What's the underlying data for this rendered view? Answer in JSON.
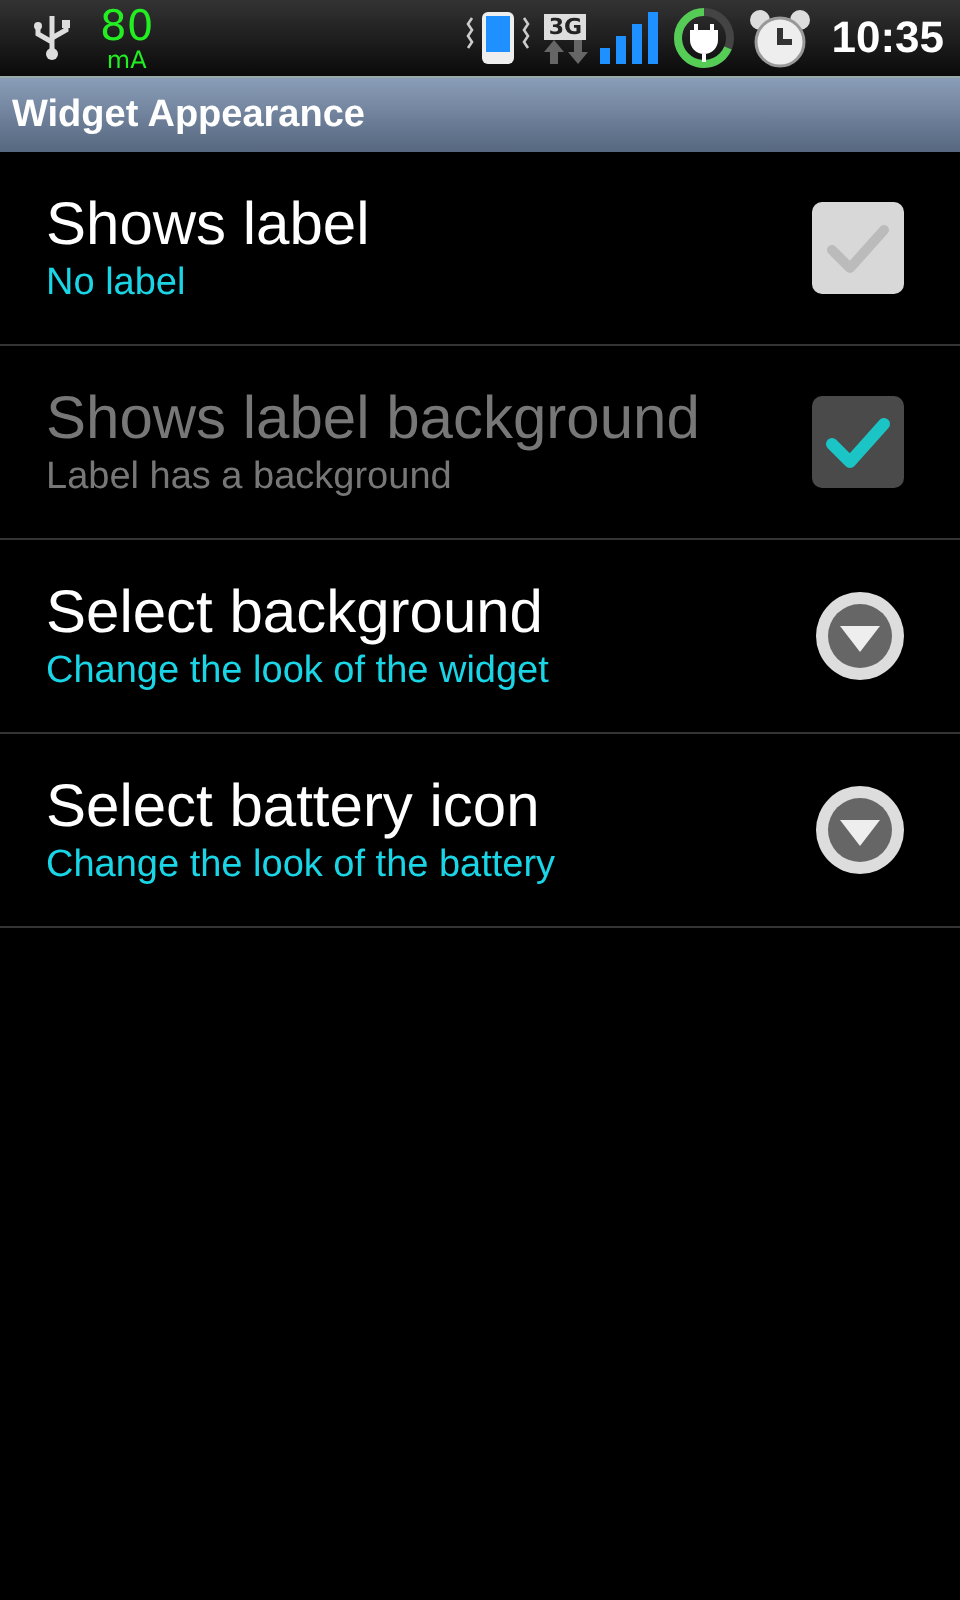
{
  "status_bar": {
    "usb_current": "80",
    "usb_unit": "mA",
    "network": "3G",
    "time": "10:35"
  },
  "title_bar": {
    "title": "Widget Appearance"
  },
  "preferences": [
    {
      "kind": "checkbox",
      "title": "Shows label",
      "summary": "No label",
      "checked": false,
      "disabled": false
    },
    {
      "kind": "checkbox",
      "title": "Shows label background",
      "summary": "Label has a background",
      "checked": true,
      "disabled": true
    },
    {
      "kind": "list",
      "title": "Select background",
      "summary": "Change the look of the widget",
      "disabled": false
    },
    {
      "kind": "list",
      "title": "Select battery icon",
      "summary": "Change the look of the battery",
      "disabled": false
    }
  ]
}
